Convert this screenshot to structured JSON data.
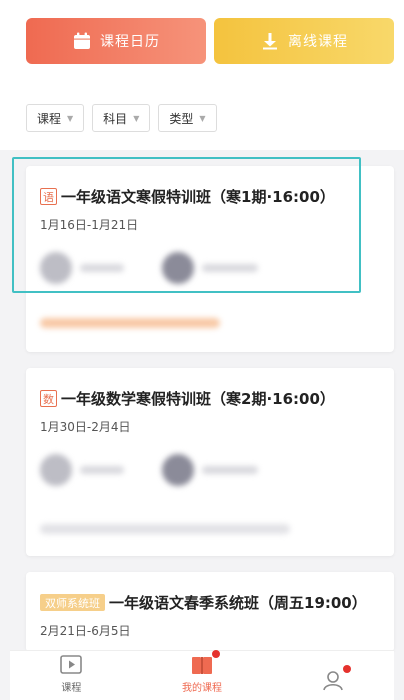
{
  "top_buttons": {
    "calendar_label": "课程日历",
    "offline_label": "离线课程"
  },
  "filters": [
    {
      "label": "课程"
    },
    {
      "label": "科目"
    },
    {
      "label": "类型"
    }
  ],
  "courses": [
    {
      "subject_tag": "语",
      "title": "一年级语文寒假特训班（寒1期·16:00）",
      "dates": "1月16日-1月21日"
    },
    {
      "subject_tag": "数",
      "title": "一年级数学寒假特训班（寒2期·16:00）",
      "dates": "1月30日-2月4日"
    },
    {
      "subject_tag": "双师系统班",
      "title": "一年级语文春季系统班（周五19:00）",
      "dates": "2月21日-6月5日"
    }
  ],
  "bottom_nav": {
    "items": [
      {
        "label": "课程",
        "active": false
      },
      {
        "label": "我的课程",
        "active": true
      },
      {
        "label": "",
        "active": false
      }
    ]
  },
  "colors": {
    "calendar_button": "#ef6a51",
    "offline_button": "#f4c33e",
    "subject_tag": "#e8704f",
    "highlight": "#41c0c4",
    "active_nav": "#ef6a51",
    "notification_dot": "#e5322d"
  }
}
